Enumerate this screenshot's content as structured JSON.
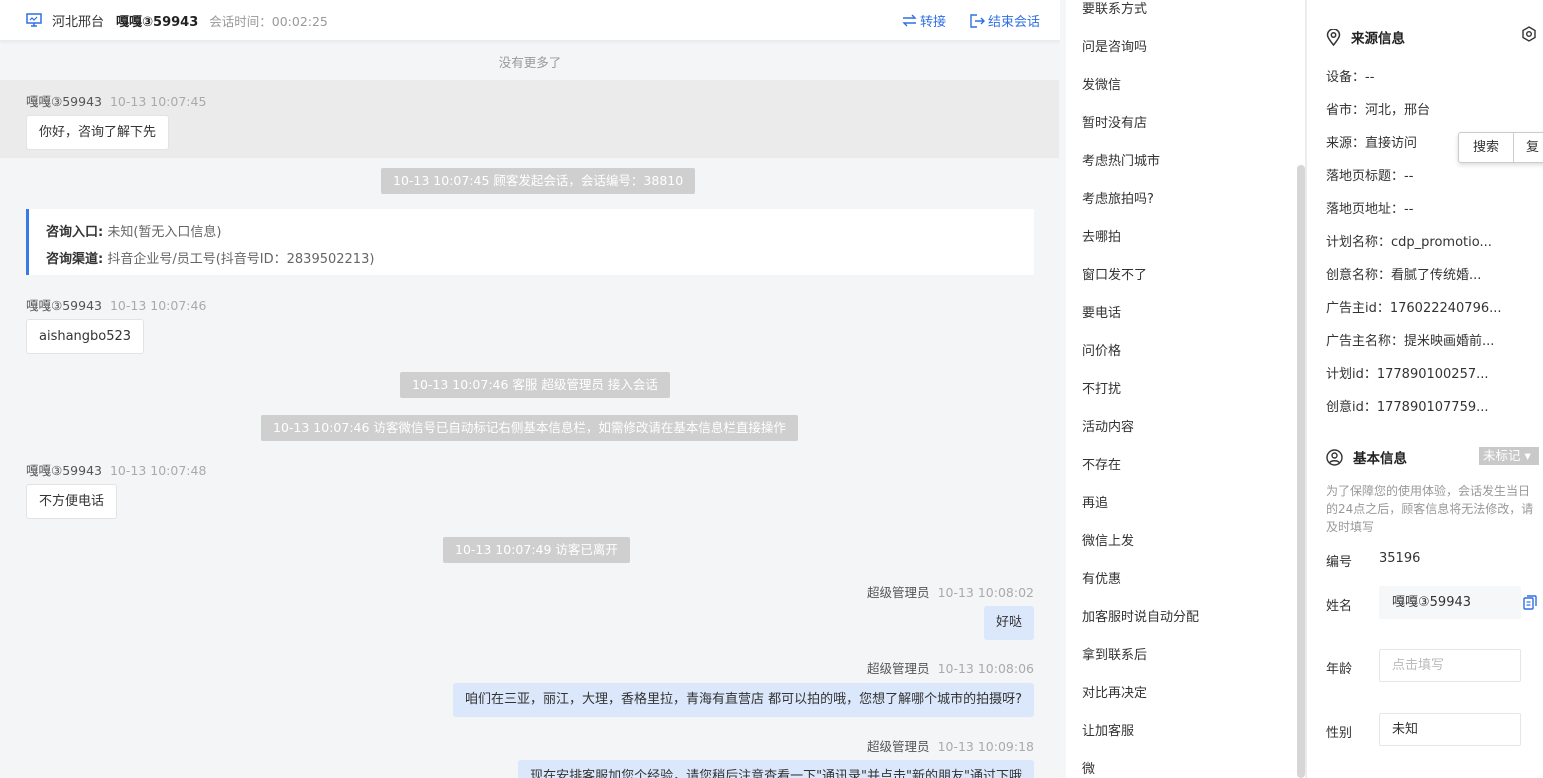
{
  "header": {
    "location": "河北邢台",
    "visitor_name": "嘎嘎③59943",
    "session_time": "会话时间：00:02:25",
    "transfer_label": "转接",
    "end_label": "结束会话"
  },
  "chat": {
    "no_more": "没有更多了",
    "msg1": {
      "sender": "嘎嘎③59943",
      "time": "10-13 10:07:45",
      "text": "你好，咨询了解下先"
    },
    "sys1": "10-13 10:07:45 顾客发起会话，会话编号：38810",
    "entry": {
      "entry_label": "咨询入口:",
      "entry_value": " 未知(暂无入口信息)",
      "channel_label": "咨询渠道:",
      "channel_value": " 抖音企业号/员工号(抖音号ID：2839502213)"
    },
    "msg2": {
      "sender": "嘎嘎③59943",
      "time": "10-13 10:07:46",
      "text": "aishangbo523"
    },
    "sys2": "10-13 10:07:46 客服 超级管理员 接入会话",
    "sys3": "10-13 10:07:46 访客微信号已自动标记右侧基本信息栏，如需修改请在基本信息栏直接操作",
    "msg3": {
      "sender": "嘎嘎③59943",
      "time": "10-13 10:07:48",
      "text": "不方便电话"
    },
    "sys4": "10-13 10:07:49 访客已离开",
    "msg4": {
      "sender": "超级管理员",
      "time": "10-13 10:08:02",
      "text": "好哒"
    },
    "msg5": {
      "sender": "超级管理员",
      "time": "10-13 10:08:06",
      "text": "咱们在三亚，丽江，大理，香格里拉，青海有直营店 都可以拍的哦，您想了解哪个城市的拍摄呀?"
    },
    "msg6": {
      "sender": "超级管理员",
      "time": "10-13 10:09:18",
      "text": "现在安排客服加您个经验，请您稍后注意查看一下\"通讯录\"并点击\"新的朋友\"通过下哦"
    }
  },
  "quick_replies": [
    "要联系方式",
    "问是咨询吗",
    "发微信",
    "暂时没有店",
    "考虑热门城市",
    "考虑旅拍吗?",
    "去哪拍",
    "窗口发不了",
    "要电话",
    "问价格",
    "不打扰",
    "活动内容",
    "不存在",
    "再追",
    "微信上发",
    "有优惠",
    "加客服时说自动分配",
    "拿到联系后",
    "对比再决定",
    "让加客服",
    "微"
  ],
  "source_info": {
    "title": "来源信息",
    "rows": [
      "设备：--",
      "省市：河北，邢台",
      "来源：直接访问",
      "落地页标题：--",
      "落地页地址：--",
      "计划名称：cdp_promotio...",
      "创意名称：看腻了传统婚...",
      "广告主id：176022240796...",
      "广告主名称：提米映画婚前...",
      "计划id：177890100257...",
      "创意id：177890107759..."
    ]
  },
  "search_popup": {
    "search": "搜索",
    "copy": "复"
  },
  "basic_info": {
    "title": "基本信息",
    "tag": "未标记 ▾",
    "note": "为了保障您的使用体验，会话发生当日的24点之后，顾客信息将无法修改，请及时填写",
    "id_label": "编号",
    "id_value": "35196",
    "name_label": "姓名",
    "name_value": "嘎嘎③59943",
    "age_label": "年龄",
    "age_placeholder": "点击填写",
    "gender_label": "性别",
    "gender_value": "未知"
  }
}
